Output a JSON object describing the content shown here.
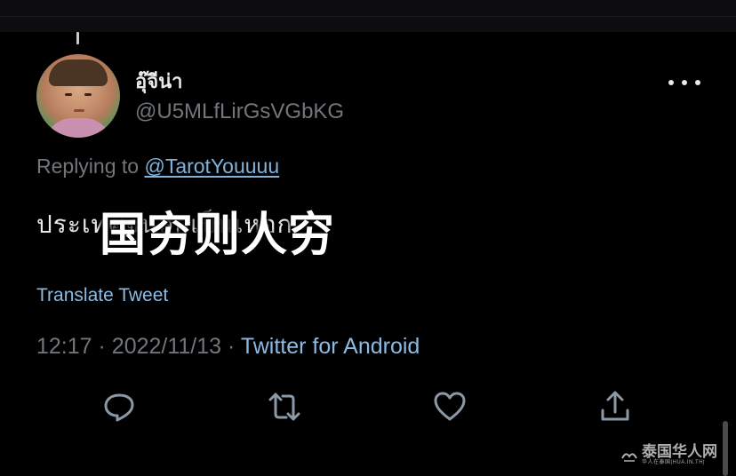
{
  "tweet": {
    "display_name": "อุ๊จีน่า",
    "handle": "@U5MLfLirGsVGbKG",
    "replying_prefix": "Replying to",
    "replying_to": "@TarotYouuuu",
    "text": "ประเทศจนลูกเป็นเหอก",
    "overlay_caption": "国穷则人穷",
    "translate_label": "Translate Tweet",
    "time": "12:17",
    "date": "2022/11/13",
    "separator": "·",
    "source": "Twitter for Android"
  },
  "icons": {
    "more": "more-horizontal-icon",
    "reply": "reply-icon",
    "retweet": "retweet-icon",
    "like": "heart-icon",
    "share": "share-icon"
  },
  "watermark": {
    "main": "泰国华人网",
    "sub": "华人在泰国|HUA.IN.TH|"
  },
  "colors": {
    "background": "#000000",
    "text": "#e7e9ea",
    "muted": "#71767b",
    "link": "#8bbbe4"
  }
}
